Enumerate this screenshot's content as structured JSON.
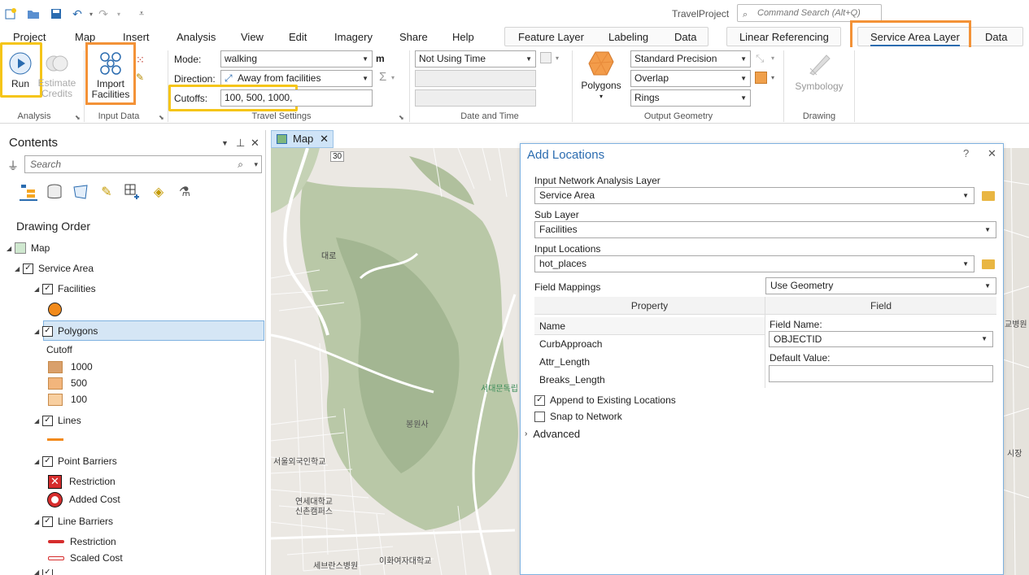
{
  "app": {
    "title": "TravelProject",
    "command_search_placeholder": "Command Search (Alt+Q)"
  },
  "tabs": [
    "Project",
    "Map",
    "Insert",
    "Analysis",
    "View",
    "Edit",
    "Imagery",
    "Share",
    "Help"
  ],
  "context_tabs_1": [
    "Feature Layer",
    "Labeling",
    "Data"
  ],
  "context_tabs_2": [
    "Linear Referencing"
  ],
  "context_tabs_3": [
    "Service Area Layer",
    "Data"
  ],
  "ribbon": {
    "analysis": {
      "run": "Run",
      "estimate_credits": "Estimate\nCredits",
      "group": "Analysis"
    },
    "input_data": {
      "import_facilities": "Import\nFacilities",
      "group": "Input Data"
    },
    "travel_settings": {
      "mode_label": "Mode:",
      "mode_value": "walking",
      "units": "m",
      "direction_label": "Direction:",
      "direction_value": "Away from facilities",
      "cutoffs_label": "Cutoffs:",
      "cutoffs_value": "100, 500, 1000,",
      "group": "Travel Settings"
    },
    "date_time": {
      "time_value": "Not Using Time",
      "group": "Date and Time"
    },
    "output_geometry": {
      "polygons": "Polygons",
      "precision": "Standard Precision",
      "overlap": "Overlap",
      "rings": "Rings",
      "group": "Output Geometry"
    },
    "drawing": {
      "symbology": "Symbology",
      "group": "Drawing"
    }
  },
  "contents": {
    "title": "Contents",
    "search_placeholder": "Search",
    "drawing_order": "Drawing Order",
    "map": "Map",
    "service_area": "Service Area",
    "facilities": "Facilities",
    "polygons": "Polygons",
    "cutoff": "Cutoff",
    "cutoff_classes": [
      {
        "label": "1000",
        "color": "#d9a06b"
      },
      {
        "label": "500",
        "color": "#f2b57c"
      },
      {
        "label": "100",
        "color": "#f8cfa0"
      }
    ],
    "lines": "Lines",
    "point_barriers": "Point Barriers",
    "restriction": "Restriction",
    "added_cost": "Added Cost",
    "line_barriers": "Line Barriers",
    "line_restriction": "Restriction",
    "scaled_cost": "Scaled Cost"
  },
  "map_tab": "Map",
  "map_labels": {
    "a": "30",
    "b": "서대문독립",
    "c": "봉원사",
    "d": "서울외국인학교",
    "e": "연세대학교\n신촌캠퍼스",
    "f": "세브란스병원",
    "g": "이화여자대학교",
    "h": "교병원",
    "i": "시장",
    "j": "대로"
  },
  "dialog": {
    "title": "Add Locations",
    "input_layer_label": "Input Network Analysis Layer",
    "input_layer_value": "Service Area",
    "sub_layer_label": "Sub Layer",
    "sub_layer_value": "Facilities",
    "input_locations_label": "Input Locations",
    "input_locations_value": "hot_places",
    "field_mappings_label": "Field Mappings",
    "field_mappings_value": "Use Geometry",
    "property_header": "Property",
    "field_header": "Field",
    "name_header": "Name",
    "properties": [
      "CurbApproach",
      "Attr_Length",
      "Breaks_Length"
    ],
    "field_name_label": "Field Name:",
    "field_name_value": "OBJECTID",
    "default_value_label": "Default Value:",
    "append_label": "Append to Existing Locations",
    "snap_label": "Snap to Network",
    "advanced_label": "Advanced"
  }
}
